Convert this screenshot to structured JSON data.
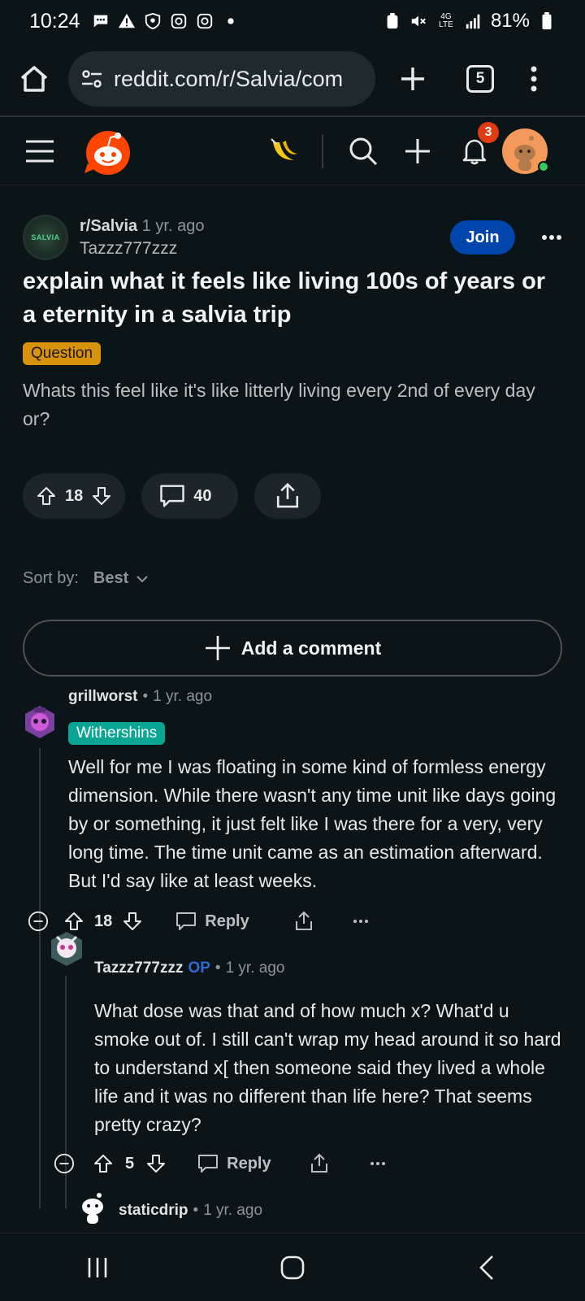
{
  "status_bar": {
    "time": "10:24",
    "network": "4G LTE",
    "battery": "81%"
  },
  "browser": {
    "url": "reddit.com/r/Salvia/com",
    "tab_count": "5"
  },
  "header": {
    "notification_count": "3"
  },
  "post": {
    "subreddit": "r/Salvia",
    "age": "1 yr. ago",
    "author": "Tazzz777zzz",
    "subreddit_avatar_text": "SALVIA",
    "join_label": "Join",
    "title": "explain what it feels like living 100s of years or a eternity in a salvia trip",
    "flair": "Question",
    "body": "Whats this feel like it's like litterly living every 2nd of every day or?",
    "votes": "18",
    "comments": "40"
  },
  "sort": {
    "label": "Sort by:",
    "value": "Best"
  },
  "add_comment_label": "Add a comment",
  "comments": [
    {
      "user": "grillworst",
      "age": "1 yr. ago",
      "flair": "Withershins",
      "body": "Well for me I was floating in some kind of formless energy dimension. While there wasn't any time unit like days going by or something, it just felt like I was there for a very, very long time. The time unit came as an estimation afterward. But I'd say like at least weeks.",
      "votes": "18",
      "reply_label": "Reply"
    },
    {
      "user": "Tazzz777zzz",
      "op_tag": "OP",
      "age": "1 yr. ago",
      "body": "What dose was that and of how much x? What'd u smoke out of. I still can't wrap my head around it so hard to understand x[ then someone said they lived a whole life and it was no different than life here? That seems pretty crazy?",
      "votes": "5",
      "reply_label": "Reply"
    },
    {
      "user": "staticdrip",
      "age": "1 yr. ago"
    }
  ],
  "colors": {
    "background": "#0b1416",
    "join_button": "#0045ac",
    "question_flair": "#d8920e",
    "user_flair": "#0aa693",
    "op_tag": "#2e6bd6",
    "notification_badge": "#e03b12"
  }
}
